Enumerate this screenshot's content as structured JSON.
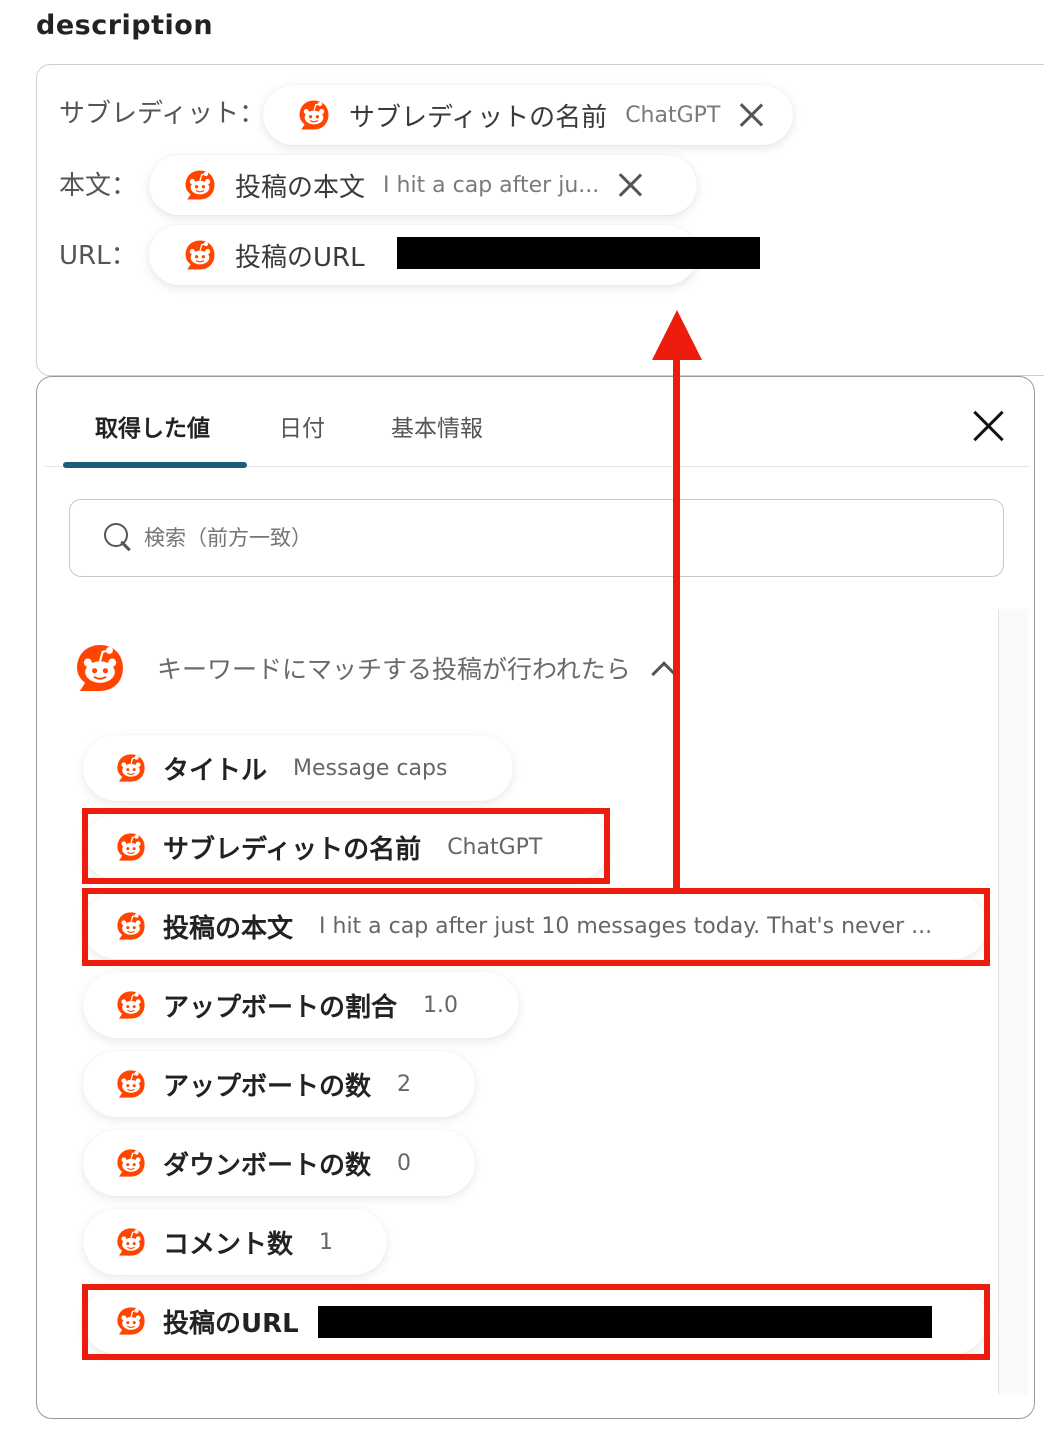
{
  "field_label": "description",
  "editor": {
    "rows": [
      {
        "label": "サブレディット：",
        "chip_name": "サブレディットの名前",
        "chip_value": "ChatGPT"
      },
      {
        "label": "本文：",
        "chip_name": "投稿の本文",
        "chip_value": "I hit a cap after ju..."
      },
      {
        "label": "URL：",
        "chip_name": "投稿のURL",
        "chip_value": ""
      }
    ]
  },
  "panel": {
    "tabs": [
      {
        "label": "取得した値",
        "active": true
      },
      {
        "label": "日付",
        "active": false
      },
      {
        "label": "基本情報",
        "active": false
      }
    ],
    "search_placeholder": "検索（前方一致）",
    "trigger_title": "キーワードにマッチする投稿が行われたら",
    "items": [
      {
        "name": "タイトル",
        "value": "Message caps",
        "highlighted": false
      },
      {
        "name": "サブレディットの名前",
        "value": "ChatGPT",
        "highlighted": true
      },
      {
        "name": "投稿の本文",
        "value": "I hit a cap after just 10 messages today. That's never ...",
        "highlighted": true
      },
      {
        "name": "アップボートの割合",
        "value": "1.0",
        "highlighted": false
      },
      {
        "name": "アップボートの数",
        "value": "2",
        "highlighted": false
      },
      {
        "name": "ダウンボートの数",
        "value": "0",
        "highlighted": false
      },
      {
        "name": "コメント数",
        "value": "1",
        "highlighted": false
      },
      {
        "name": "投稿のURL",
        "value": "",
        "highlighted": true
      }
    ]
  },
  "colors": {
    "highlight": "#ee1c0d",
    "reddit_orange": "#ff4500",
    "tab_accent": "#1d5d7a"
  },
  "icons": {
    "chip_icon": "reddit-icon",
    "close": "close-icon",
    "search": "search-icon",
    "collapse": "chevron-up-icon"
  }
}
